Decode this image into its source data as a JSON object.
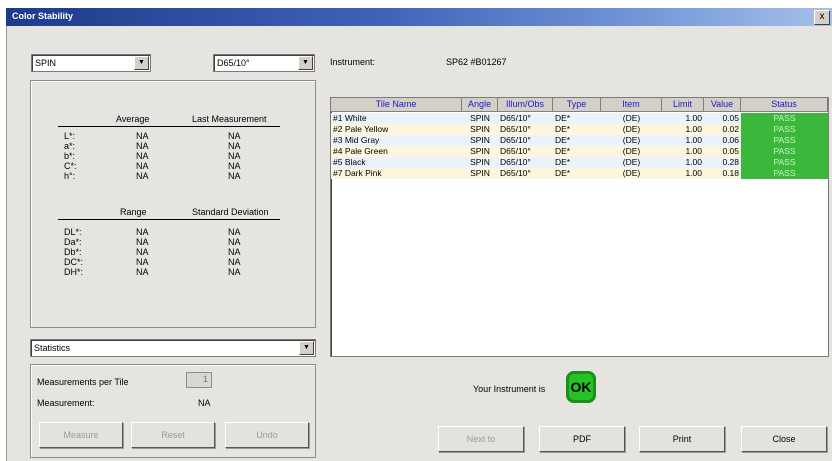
{
  "window": {
    "title": "Color Stability",
    "close_glyph": "x"
  },
  "angle_select": {
    "value": "SPIN"
  },
  "illum_select": {
    "value": "D65/10°"
  },
  "instrument": {
    "label": "Instrument:",
    "value": "SP62   #B01267"
  },
  "stats": {
    "avg_header": "Average",
    "last_header": "Last Measurement",
    "rows1": [
      {
        "label": "L*:",
        "avg": "NA",
        "last": "NA"
      },
      {
        "label": "a*:",
        "avg": "NA",
        "last": "NA"
      },
      {
        "label": "b*:",
        "avg": "NA",
        "last": "NA"
      },
      {
        "label": "C*:",
        "avg": "NA",
        "last": "NA"
      },
      {
        "label": "h°:",
        "avg": "NA",
        "last": "NA"
      }
    ],
    "range_header": "Range",
    "stddev_header": "Standard Deviation",
    "rows2": [
      {
        "label": "DL*:",
        "range": "NA",
        "sd": "NA"
      },
      {
        "label": "Da*:",
        "range": "NA",
        "sd": "NA"
      },
      {
        "label": "Db*:",
        "range": "NA",
        "sd": "NA"
      },
      {
        "label": "DC*:",
        "range": "NA",
        "sd": "NA"
      },
      {
        "label": "DH*:",
        "range": "NA",
        "sd": "NA"
      }
    ]
  },
  "view_select": {
    "value": "Statistics"
  },
  "measure_panel": {
    "per_tile_label": "Measurements per Tile",
    "per_tile_value": "1",
    "measurement_label": "Measurement:",
    "measurement_value": "NA"
  },
  "buttons": {
    "measure": "Measure",
    "reset": "Reset",
    "undo": "Undo",
    "next": "Next to",
    "pdf": "PDF",
    "print": "Print",
    "close": "Close"
  },
  "table": {
    "headers": [
      "Tile Name",
      "Angle",
      "Illum/Obs",
      "Type",
      "Item",
      "Limit",
      "Value",
      "Status"
    ],
    "rows": [
      {
        "name": "#1 White",
        "angle": "SPIN",
        "illum": "D65/10°",
        "type": "DE*",
        "item": "(DE)",
        "limit": "1.00",
        "value": "0.05",
        "status": "PASS"
      },
      {
        "name": "#2 Pale Yellow",
        "angle": "SPIN",
        "illum": "D65/10°",
        "type": "DE*",
        "item": "(DE)",
        "limit": "1.00",
        "value": "0.02",
        "status": "PASS"
      },
      {
        "name": "#3 Mid Gray",
        "angle": "SPIN",
        "illum": "D65/10°",
        "type": "DE*",
        "item": "(DE)",
        "limit": "1.00",
        "value": "0.06",
        "status": "PASS"
      },
      {
        "name": "#4 Pale Green",
        "angle": "SPIN",
        "illum": "D65/10°",
        "type": "DE*",
        "item": "(DE)",
        "limit": "1.00",
        "value": "0.05",
        "status": "PASS"
      },
      {
        "name": "#5 Black",
        "angle": "SPIN",
        "illum": "D65/10°",
        "type": "DE*",
        "item": "(DE)",
        "limit": "1.00",
        "value": "0.28",
        "status": "PASS"
      },
      {
        "name": "#7 Dark Pink",
        "angle": "SPIN",
        "illum": "D65/10°",
        "type": "DE*",
        "item": "(DE)",
        "limit": "1.00",
        "value": "0.18",
        "status": "PASS"
      }
    ]
  },
  "instrument_status": {
    "label": "Your Instrument is",
    "badge": "OK"
  },
  "colors": {
    "title_bar": "#1d3a8a",
    "pass_green": "#3bb83b",
    "ok_green": "#27c227"
  }
}
